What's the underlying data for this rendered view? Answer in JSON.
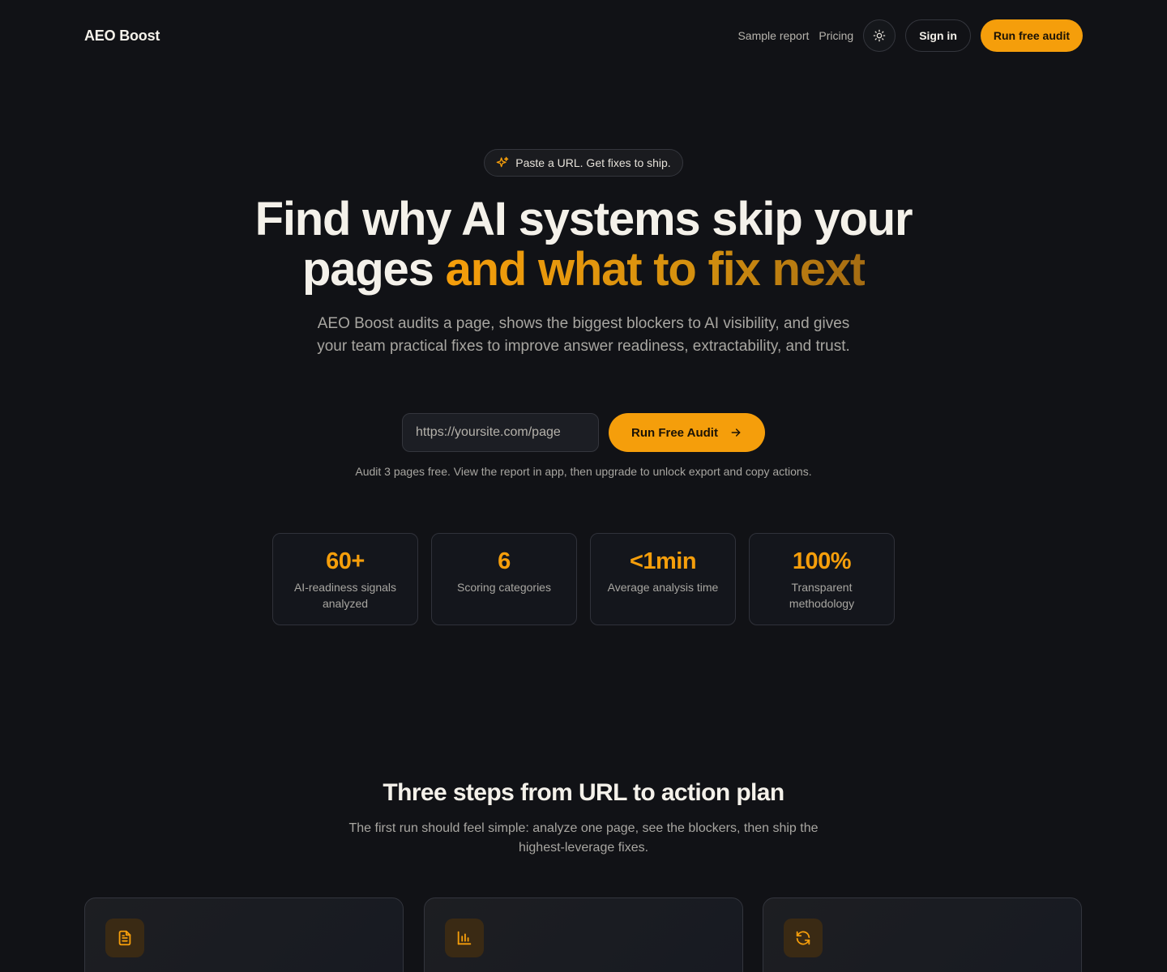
{
  "nav": {
    "brand": "AEO Boost",
    "links": [
      "Sample report",
      "Pricing"
    ],
    "theme_icon": "sun-icon",
    "signin_label": "Sign in",
    "cta_label": "Run free audit"
  },
  "hero": {
    "pill_icon": "sparkle-icon",
    "pill_text": "Paste a URL. Get fixes to ship.",
    "headline_main_1": "Find why AI systems skip your",
    "headline_main_2": "pages ",
    "headline_accent": "and what to fix next",
    "subheadline": "AEO Boost audits a page, shows the biggest blockers to AI visibility, and gives your team practical fixes to improve answer readiness, extractability, and trust.",
    "url_placeholder": "https://yoursite.com/page",
    "run_label": "Run Free Audit",
    "run_icon": "arrow-right-icon",
    "note": "Audit 3 pages free. View the report in app, then upgrade to unlock export and copy actions."
  },
  "stats": [
    {
      "value": "60+",
      "label": "AI-readiness signals analyzed"
    },
    {
      "value": "6",
      "label": "Scoring categories"
    },
    {
      "value": "<1min",
      "label": "Average analysis time"
    },
    {
      "value": "100%",
      "label": "Transparent methodology"
    }
  ],
  "steps": {
    "title": "Three steps from URL to action plan",
    "subtitle": "The first run should feel simple: analyze one page, see the blockers, then ship the highest-leverage fixes.",
    "icons": [
      "document-icon",
      "bar-chart-icon",
      "refresh-icon"
    ]
  },
  "colors": {
    "background": "#111216",
    "accent": "#f59e0b",
    "text": "#f4f1ea",
    "muted": "#a8a6a1"
  }
}
